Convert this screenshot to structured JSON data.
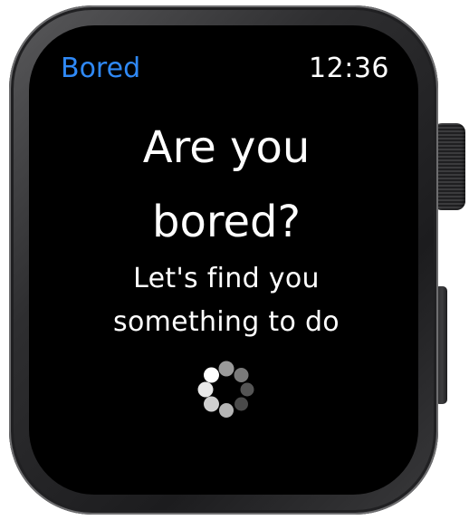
{
  "app": {
    "title": "Bored",
    "accent_color": "#2f89f6"
  },
  "status": {
    "time": "12:36"
  },
  "main": {
    "headline_line1": "Are you",
    "headline_line2": "bored?",
    "subtitle_line1": "Let's find you",
    "subtitle_line2": "something to do"
  },
  "loading": {
    "indicator": "activity-spinner",
    "state": "loading"
  }
}
